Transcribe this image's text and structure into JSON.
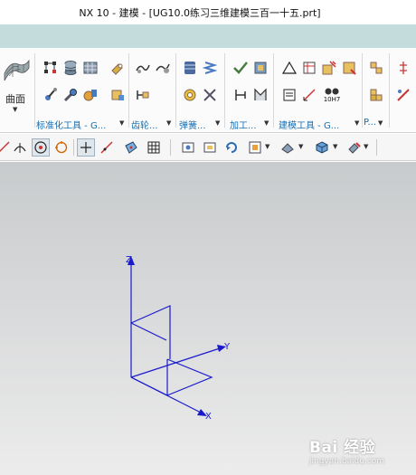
{
  "window": {
    "title": "NX 10 - 建模 - [UG10.0练习三维建模三百一十五.prt]"
  },
  "ribbon": {
    "surface_label": "曲面",
    "groups": [
      {
        "label": "标准化工具 - G..."
      },
      {
        "label": "齿轮..."
      },
      {
        "label": "弹簧..."
      },
      {
        "label": "加工..."
      },
      {
        "label": "建模工具 - G..."
      },
      {
        "label": "P..."
      }
    ],
    "hole_fit_label": "10H7"
  },
  "viewport": {
    "axes": {
      "x": "X",
      "y": "Y",
      "z": "Z"
    }
  },
  "watermark": {
    "brand": "Bai 经验",
    "url": "jingyan.baidu.com"
  },
  "colors": {
    "axis": "#1a1acc",
    "group_label": "#1a6fb0"
  }
}
